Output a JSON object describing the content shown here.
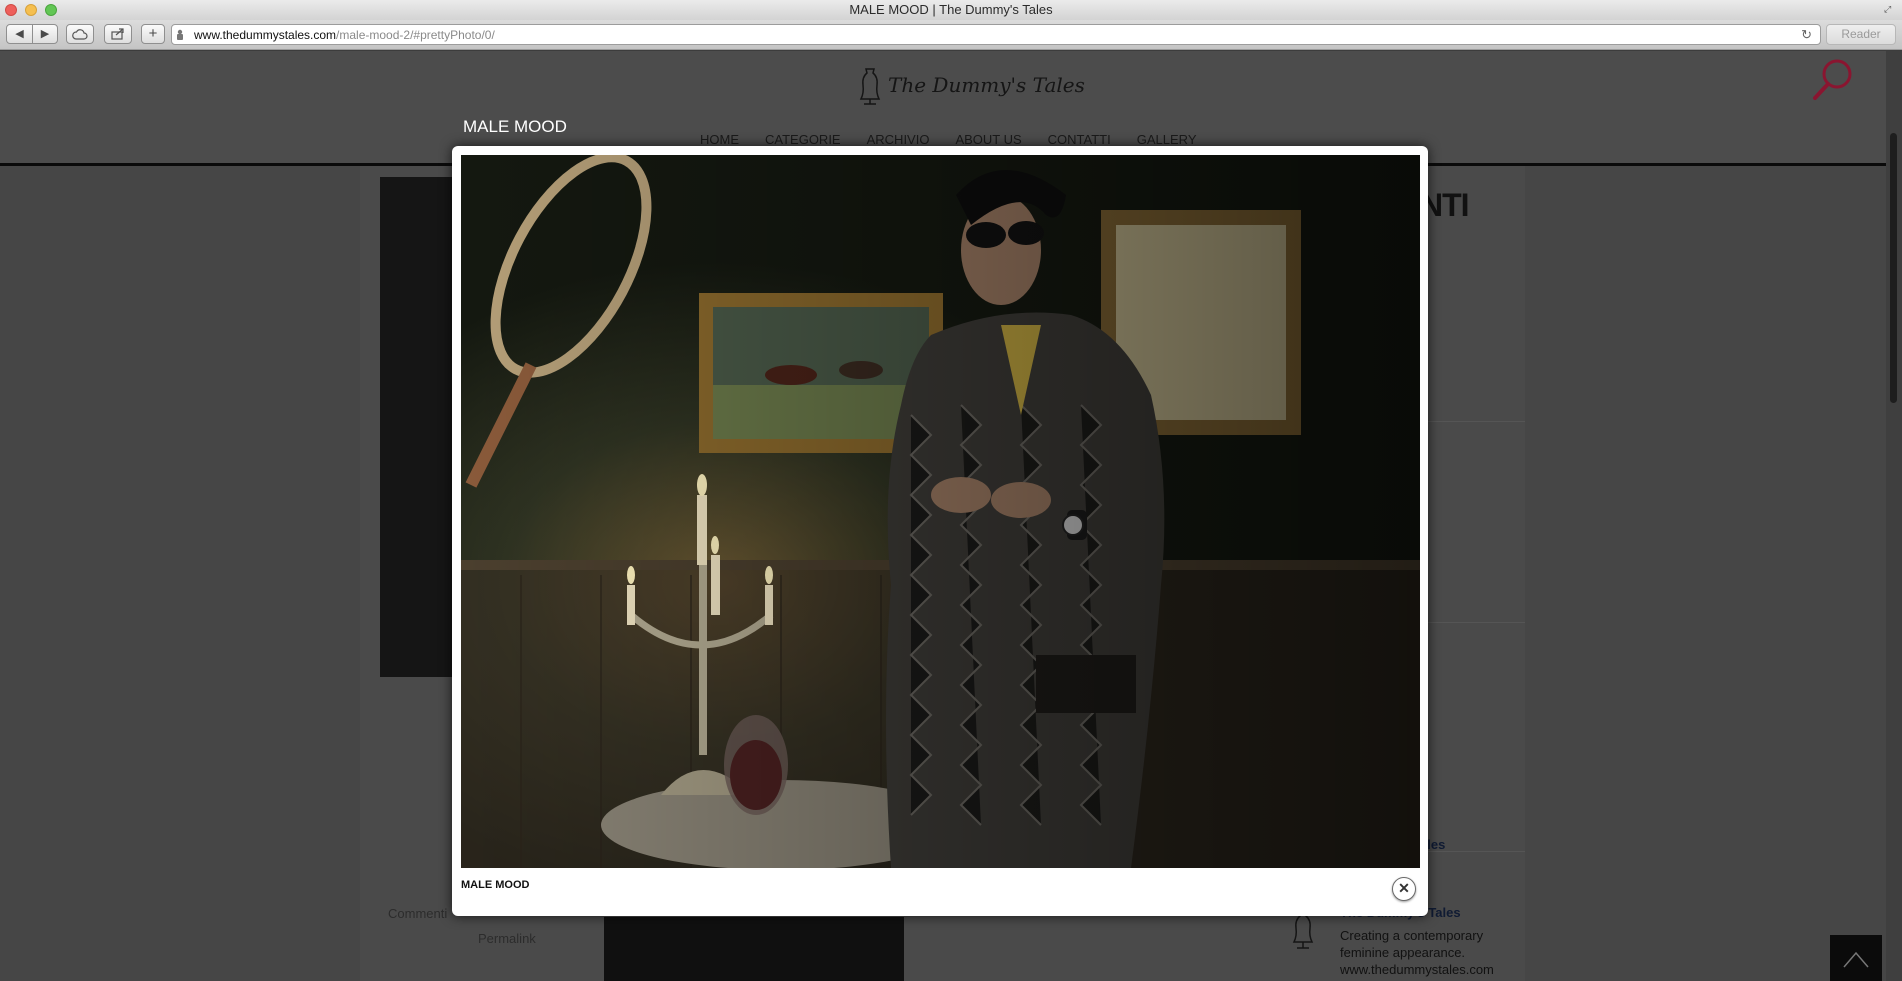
{
  "window": {
    "title": "MALE MOOD | The Dummy's Tales"
  },
  "toolbar": {
    "back_icon": "◀",
    "forward_icon": "▶",
    "plus_icon": "+",
    "url_host": "www.thedummystales.com",
    "url_path": "/male-mood-2/#prettyPhoto/0/",
    "reader_label": "Reader"
  },
  "site": {
    "logo_text": "The Dummy's Tales",
    "nav": [
      "HOME",
      "CATEGORIE",
      "ARCHIVIO",
      "ABOUT US",
      "CONTATTI",
      "GALLERY"
    ],
    "sidebar_heading": "NTI",
    "meta_comment": "Commenti",
    "meta_permalink": "Permalink",
    "sidebar_link": "ales",
    "sidebar_author": "The Dummy's Tales",
    "sidebar_desc": "Creating a contemporary feminine appearance.",
    "sidebar_url": "www.thedummystales.com"
  },
  "lightbox": {
    "title": "MALE MOOD",
    "caption": "MALE MOOD",
    "close_icon": "✕"
  },
  "colors": {
    "accent_search": "#8a1530",
    "overlay": "#464646",
    "lightbox_bg": "#ffffff"
  },
  "icons": [
    "fullscreen-icon",
    "back-arrow-icon",
    "forward-arrow-icon",
    "icloud-icon",
    "share-icon",
    "new-tab-icon",
    "lock-icon",
    "reload-icon",
    "search-icon",
    "close-icon",
    "scroll-top-icon"
  ]
}
